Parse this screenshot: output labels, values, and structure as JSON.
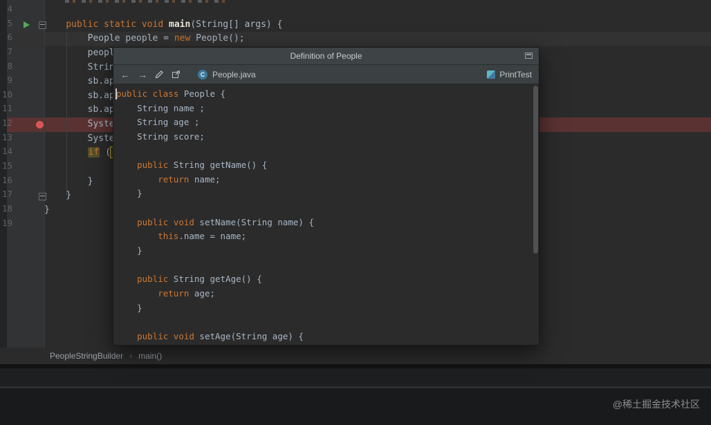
{
  "icons": {
    "back": "←",
    "forward": "→",
    "breadcrumb_chevron": "›",
    "class_letter": "C"
  },
  "colors": {
    "editor_bg": "#2b2b2b",
    "gutter_bg": "#313335",
    "line_number": "#606366",
    "current_line_bg": "#323232",
    "breakpoint_line_bg": "#5b3232",
    "breakpoint_dot": "#d65656",
    "run_arrow": "#55a85a",
    "if_highlight_bg": "#544f2a",
    "match_box_border": "#b5a242",
    "match_box_bg": "#463f22",
    "tokens": {
      "kw": "#cc7832",
      "def": "#a9b7c6",
      "fn": "#e8e4d8",
      "kwhl": "#cc7832",
      "selbox": "#a9b7c6"
    }
  },
  "editor": {
    "first_line": 4,
    "last_line": 19,
    "current_line": 6,
    "breakpoint_line": 12,
    "run_line": 5,
    "lines": [
      {
        "n": 4,
        "tokens": []
      },
      {
        "n": 5,
        "tokens": [
          {
            "t": "    ",
            "c": "def"
          },
          {
            "t": "public static void ",
            "c": "kw"
          },
          {
            "t": "main",
            "c": "fn"
          },
          {
            "t": "(String[] args) {",
            "c": "def"
          }
        ]
      },
      {
        "n": 6,
        "tokens": [
          {
            "t": "        People people = ",
            "c": "def"
          },
          {
            "t": "new",
            "c": "kw"
          },
          {
            "t": " People();",
            "c": "def"
          }
        ]
      },
      {
        "n": 7,
        "tokens": [
          {
            "t": "        peopl",
            "c": "def"
          }
        ]
      },
      {
        "n": 8,
        "tokens": [
          {
            "t": "        Strin",
            "c": "def"
          }
        ]
      },
      {
        "n": 9,
        "tokens": [
          {
            "t": "        sb.ap",
            "c": "def"
          }
        ]
      },
      {
        "n": 10,
        "tokens": [
          {
            "t": "        sb.ap",
            "c": "def"
          }
        ]
      },
      {
        "n": 11,
        "tokens": [
          {
            "t": "        sb.ap",
            "c": "def"
          }
        ]
      },
      {
        "n": 12,
        "tokens": [
          {
            "t": "        Syste",
            "c": "def"
          }
        ]
      },
      {
        "n": 13,
        "tokens": [
          {
            "t": "        Syste",
            "c": "def"
          }
        ]
      },
      {
        "n": 14,
        "tokens": [
          {
            "t": "        ",
            "c": "def"
          },
          {
            "t": "if",
            "c": "kwhl"
          },
          {
            "t": " (",
            "c": "def"
          },
          {
            "t": " ",
            "c": "selbox"
          }
        ]
      },
      {
        "n": 15,
        "tokens": []
      },
      {
        "n": 16,
        "tokens": [
          {
            "t": "        }",
            "c": "def"
          }
        ]
      },
      {
        "n": 17,
        "tokens": [
          {
            "t": "    }",
            "c": "def"
          }
        ]
      },
      {
        "n": 18,
        "tokens": [
          {
            "t": "}",
            "c": "def"
          }
        ]
      },
      {
        "n": 19,
        "tokens": []
      }
    ]
  },
  "popup": {
    "title": "Definition of People",
    "file": "People.java",
    "module": "PrintTest",
    "lines": [
      {
        "tokens": [
          {
            "t": "public class",
            "c": "kw"
          },
          {
            "t": " People {",
            "c": "def"
          }
        ]
      },
      {
        "tokens": [
          {
            "t": "    String name ;",
            "c": "def"
          }
        ]
      },
      {
        "tokens": [
          {
            "t": "    String age ;",
            "c": "def"
          }
        ]
      },
      {
        "tokens": [
          {
            "t": "    String score;",
            "c": "def"
          }
        ]
      },
      {
        "tokens": []
      },
      {
        "tokens": [
          {
            "t": "    ",
            "c": "def"
          },
          {
            "t": "public",
            "c": "kw"
          },
          {
            "t": " String getName() {",
            "c": "def"
          }
        ]
      },
      {
        "tokens": [
          {
            "t": "        ",
            "c": "def"
          },
          {
            "t": "return",
            "c": "kw"
          },
          {
            "t": " name;",
            "c": "def"
          }
        ]
      },
      {
        "tokens": [
          {
            "t": "    }",
            "c": "def"
          }
        ]
      },
      {
        "tokens": []
      },
      {
        "tokens": [
          {
            "t": "    ",
            "c": "def"
          },
          {
            "t": "public void",
            "c": "kw"
          },
          {
            "t": " setName(String name) {",
            "c": "def"
          }
        ]
      },
      {
        "tokens": [
          {
            "t": "        ",
            "c": "def"
          },
          {
            "t": "this",
            "c": "kw"
          },
          {
            "t": ".name = name;",
            "c": "def"
          }
        ]
      },
      {
        "tokens": [
          {
            "t": "    }",
            "c": "def"
          }
        ]
      },
      {
        "tokens": []
      },
      {
        "tokens": [
          {
            "t": "    ",
            "c": "def"
          },
          {
            "t": "public",
            "c": "kw"
          },
          {
            "t": " String getAge() {",
            "c": "def"
          }
        ]
      },
      {
        "tokens": [
          {
            "t": "        ",
            "c": "def"
          },
          {
            "t": "return",
            "c": "kw"
          },
          {
            "t": " age;",
            "c": "def"
          }
        ]
      },
      {
        "tokens": [
          {
            "t": "    }",
            "c": "def"
          }
        ]
      },
      {
        "tokens": []
      },
      {
        "tokens": [
          {
            "t": "    ",
            "c": "def"
          },
          {
            "t": "public void",
            "c": "kw"
          },
          {
            "t": " setAge(String age) {",
            "c": "def"
          }
        ]
      }
    ]
  },
  "breadcrumbs": [
    "PeopleStringBuilder",
    "main()"
  ],
  "watermark": "@稀土掘金技术社区"
}
